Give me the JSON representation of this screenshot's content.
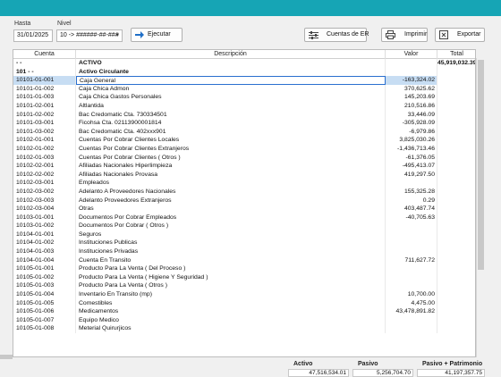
{
  "filters": {
    "hasta_label": "Hasta",
    "nivel_label": "Nivel",
    "hasta_value": "31/01/2025",
    "nivel_value": "10 -> ######-##-###"
  },
  "toolbar": {
    "ejecutar_label": "Ejecutar",
    "cuentas_er_label": "Cuentas de ER",
    "imprimir_label": "Imprimir",
    "exportar_label": "Exportar"
  },
  "grid": {
    "columns": [
      "Cuenta",
      "Descripción",
      "Valor",
      "Total"
    ],
    "rows": [
      {
        "code": "- -",
        "desc": "ACTIVO",
        "value": "",
        "total": "45,919,032.39",
        "bold": true
      },
      {
        "code": "101 - -",
        "desc": "Activo Circulante",
        "value": "",
        "total": "",
        "bold": true
      },
      {
        "code": "10101-01-001",
        "desc": "Caja General",
        "value": "-163,324.02",
        "total": "",
        "selected": true
      },
      {
        "code": "10101-01-002",
        "desc": "Caja Chica Admon",
        "value": "370,625.62",
        "total": ""
      },
      {
        "code": "10101-01-003",
        "desc": "Caja Chica Gastos Personales",
        "value": "145,203.69",
        "total": ""
      },
      {
        "code": "10101-02-001",
        "desc": "Altlantida",
        "value": "210,516.86",
        "total": ""
      },
      {
        "code": "10101-02-002",
        "desc": "Bac Credomatic Cta. 730334501",
        "value": "33,446.09",
        "total": ""
      },
      {
        "code": "10101-03-001",
        "desc": "Ficohsa  Cta. 02113900001814",
        "value": "-305,928.09",
        "total": ""
      },
      {
        "code": "10101-03-002",
        "desc": "Bac Credomatic Cta. 402xxx901",
        "value": "-6,979.86",
        "total": ""
      },
      {
        "code": "10102-01-001",
        "desc": "Cuentas Por Cobrar Clientes Locales",
        "value": "3,825,030.26",
        "total": ""
      },
      {
        "code": "10102-01-002",
        "desc": "Cuentas Por Cobrar Clientes  Extranjeros",
        "value": "-1,436,713.46",
        "total": ""
      },
      {
        "code": "10102-01-003",
        "desc": "Cuentas Por Cobrar Clientes  ( Otros )",
        "value": "-61,376.05",
        "total": ""
      },
      {
        "code": "10102-02-001",
        "desc": "Afiliadas Nacionales Hiperlimpieza",
        "value": "-495,413.07",
        "total": ""
      },
      {
        "code": "10102-02-002",
        "desc": "Afiliadas Nacionales Provasa",
        "value": "419,297.50",
        "total": ""
      },
      {
        "code": "10102-03-001",
        "desc": "Empleados",
        "value": "",
        "total": ""
      },
      {
        "code": "10102-03-002",
        "desc": "Adelanto A Proveedores Nacionales",
        "value": "155,325.28",
        "total": ""
      },
      {
        "code": "10102-03-003",
        "desc": "Adelanto Proveedores Extranjeros",
        "value": "0.29",
        "total": ""
      },
      {
        "code": "10102-03-004",
        "desc": "Otras",
        "value": "403,487.74",
        "total": ""
      },
      {
        "code": "10103-01-001",
        "desc": "Documentos Por Cobrar  Empleados",
        "value": "-40,705.63",
        "total": ""
      },
      {
        "code": "10103-01-002",
        "desc": "Documentos Por Cobrar  ( Otros )",
        "value": "",
        "total": ""
      },
      {
        "code": "10104-01-001",
        "desc": "Seguros",
        "value": "",
        "total": ""
      },
      {
        "code": "10104-01-002",
        "desc": "Instituciones Publicas",
        "value": "",
        "total": ""
      },
      {
        "code": "10104-01-003",
        "desc": "Instituciones Privadas",
        "value": "",
        "total": ""
      },
      {
        "code": "10104-01-004",
        "desc": "Cuenta En Transito",
        "value": "711,627.72",
        "total": ""
      },
      {
        "code": "10105-01-001",
        "desc": "Producto Para La Venta  ( Del Proceso )",
        "value": "",
        "total": ""
      },
      {
        "code": "10105-01-002",
        "desc": "Producto Para La Venta  ( Higiene Y Seguridad   )",
        "value": "",
        "total": ""
      },
      {
        "code": "10105-01-003",
        "desc": "Producto Para La Venta  ( Otros   )",
        "value": "",
        "total": ""
      },
      {
        "code": "10105-01-004",
        "desc": "Inventario En Transito (mp)",
        "value": "10,700.00",
        "total": ""
      },
      {
        "code": "10105-01-005",
        "desc": "Comestibles",
        "value": "4,475.00",
        "total": ""
      },
      {
        "code": "10105-01-006",
        "desc": "Medicamentos",
        "value": "43,478,891.82",
        "total": ""
      },
      {
        "code": "10105-01-007",
        "desc": "Equipo Medico",
        "value": "",
        "total": ""
      },
      {
        "code": "10105-01-008",
        "desc": "Meterial Quirurjicos",
        "value": "",
        "total": ""
      }
    ]
  },
  "footer": {
    "activo_label": "Activo",
    "pasivo_label": "Pasivo",
    "pasivo_patrimonio_label": "Pasivo + Patrimonio",
    "activo_value": "47,516,534.01",
    "pasivo_value": "5,256,704.70",
    "pasivo_patrimonio_value": "41,197,357.75"
  },
  "colors": {
    "titlebar": "#16a5b5",
    "selection": "#c7ddf3",
    "selection_border": "#2a6fcf"
  }
}
